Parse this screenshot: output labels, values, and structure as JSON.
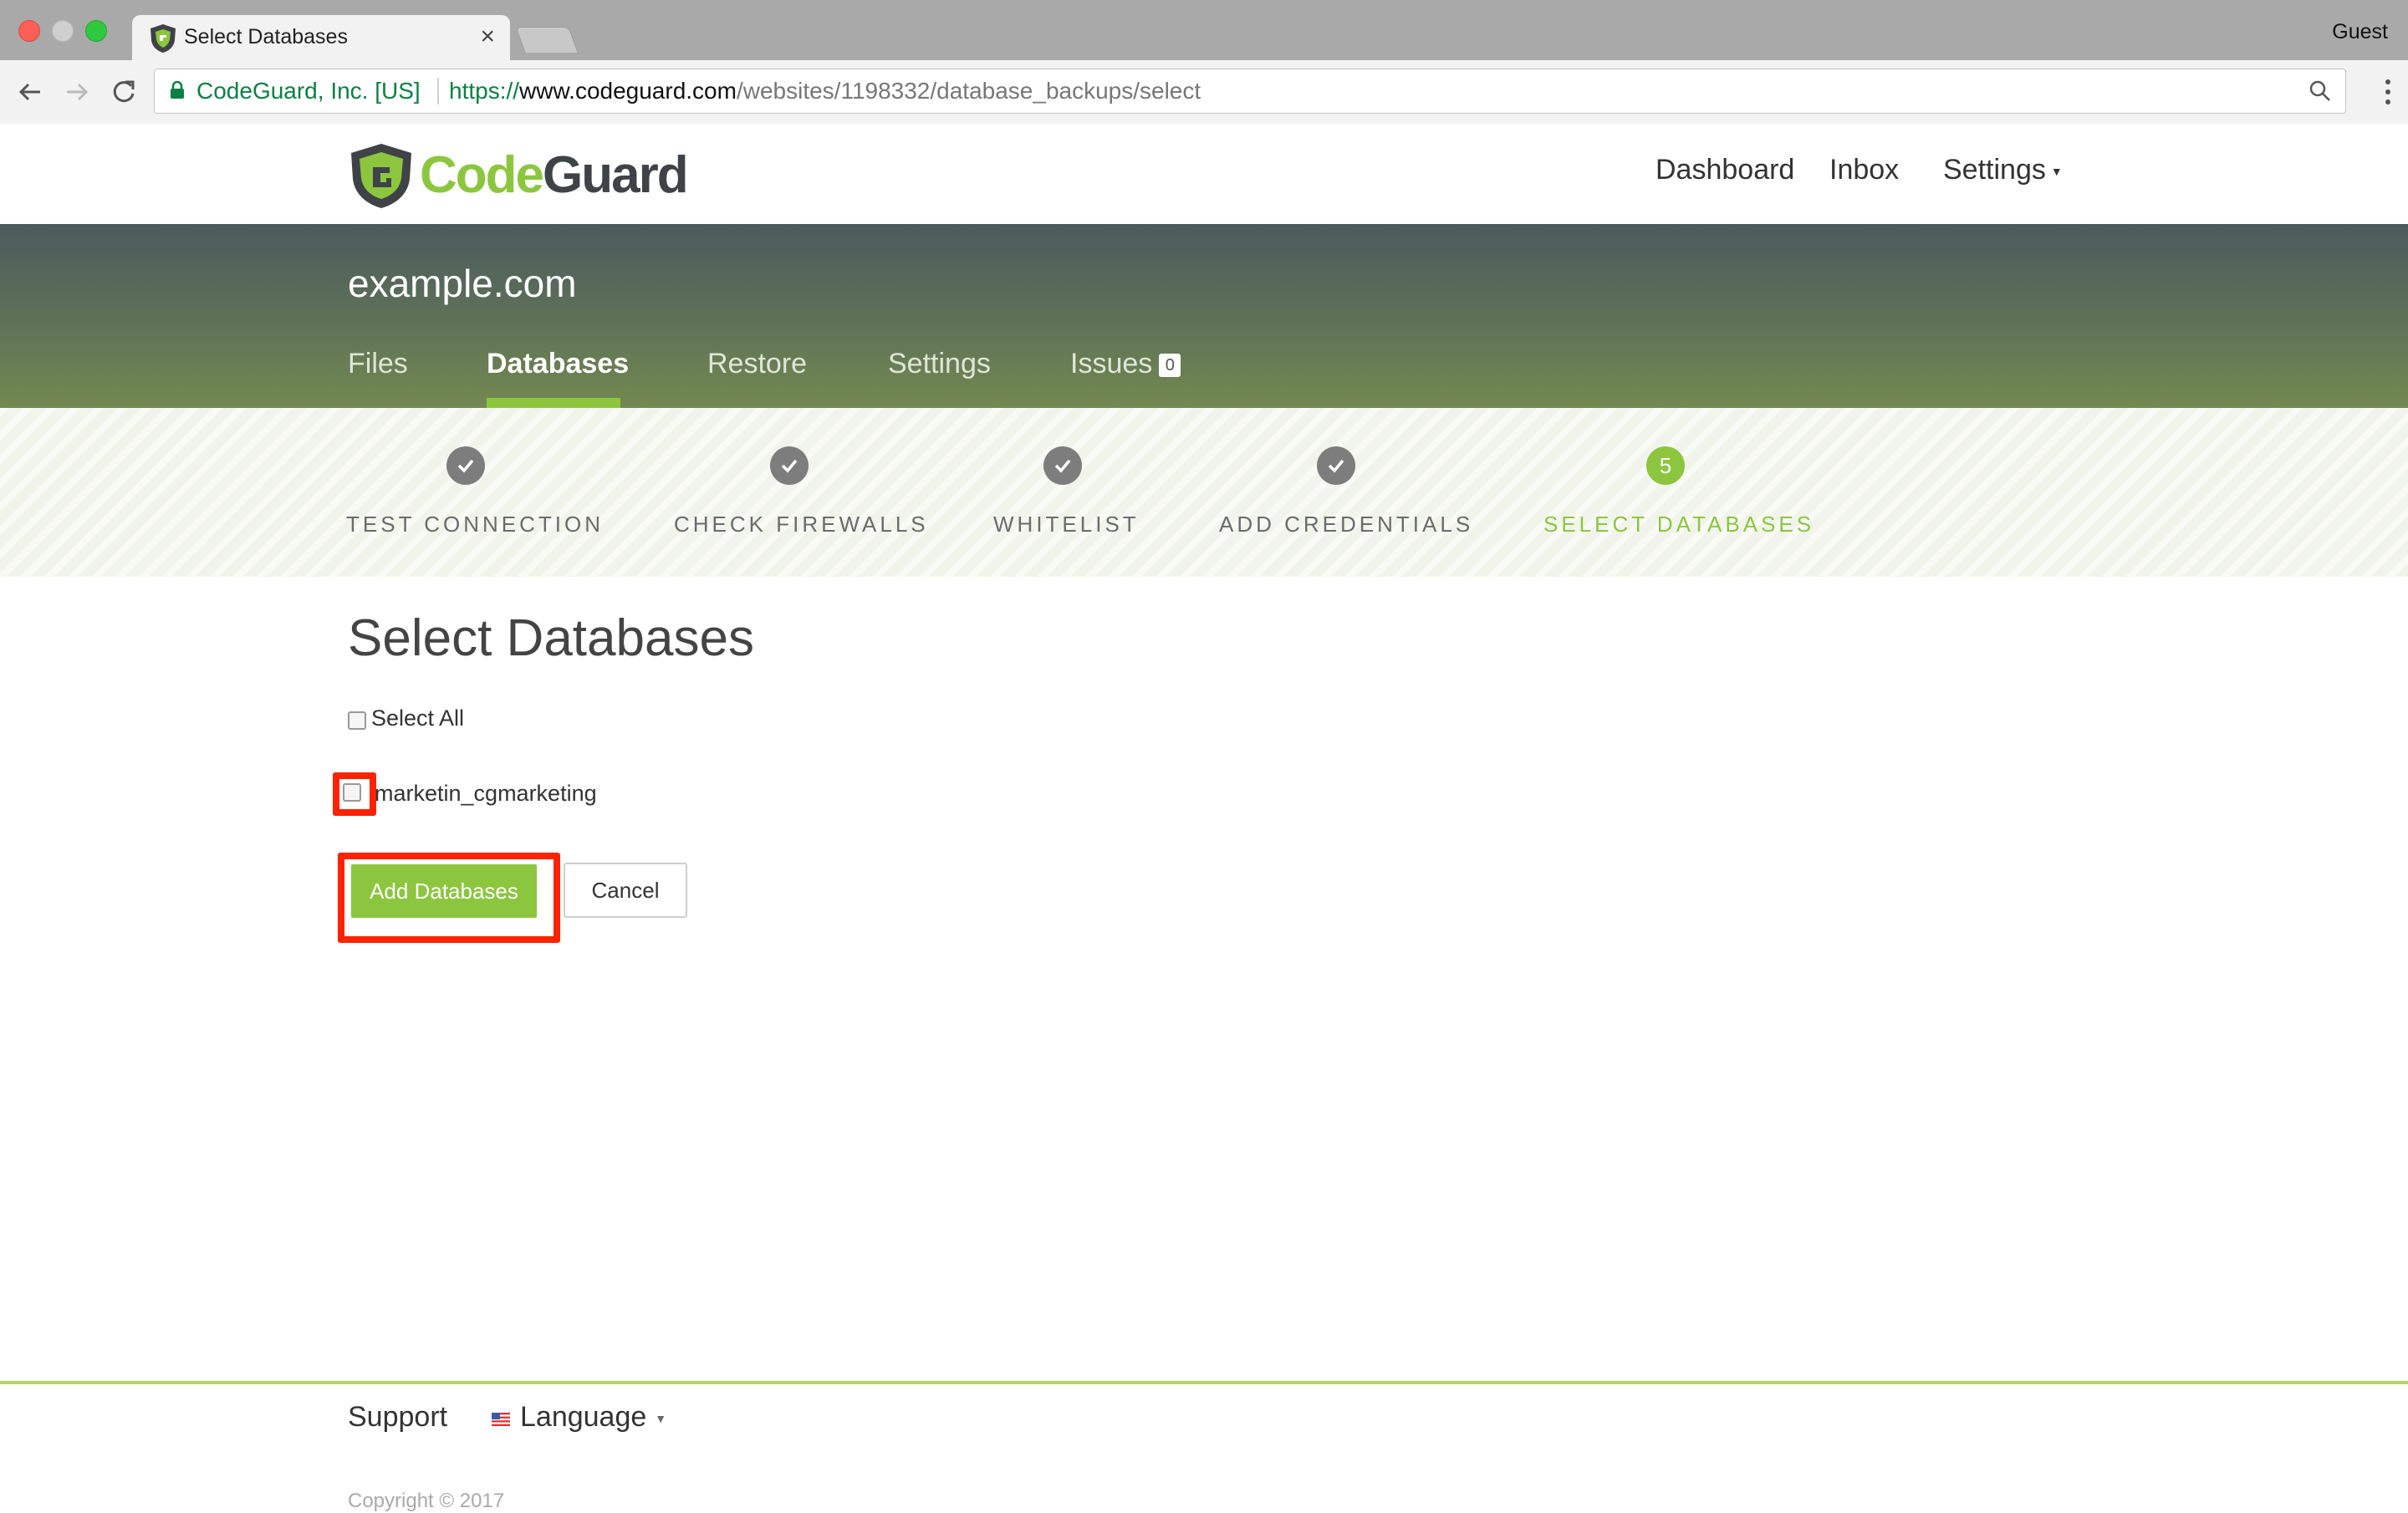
{
  "browser": {
    "tab_title": "Select Databases",
    "tab_close": "×",
    "guest_label": "Guest",
    "security_label": "CodeGuard, Inc. [US]",
    "url_scheme": "https://",
    "url_host": "www.codeguard.com",
    "url_path": "/websites/1198332/database_backups/select"
  },
  "header": {
    "logo_code": "Code",
    "logo_guard": "Guard",
    "nav": {
      "dashboard": "Dashboard",
      "inbox": "Inbox",
      "settings": "Settings"
    }
  },
  "banner": {
    "site_name": "example.com",
    "tabs": {
      "files": "Files",
      "databases": "Databases",
      "restore": "Restore",
      "settings": "Settings",
      "issues": "Issues",
      "issues_count": "0"
    },
    "active_tab": "Databases"
  },
  "wizard": {
    "steps": [
      {
        "label": "TEST CONNECTION",
        "status": "done"
      },
      {
        "label": "CHECK FIREWALLS",
        "status": "done"
      },
      {
        "label": "WHITELIST",
        "status": "done"
      },
      {
        "label": "ADD CREDENTIALS",
        "status": "done"
      },
      {
        "label": "SELECT DATABASES",
        "status": "active",
        "number": "5"
      }
    ]
  },
  "main": {
    "title": "Select Databases",
    "select_all_label": "Select All",
    "databases": [
      {
        "name": "marketin_cgmarketing",
        "checked": false
      }
    ],
    "add_button": "Add Databases",
    "cancel_button": "Cancel"
  },
  "footer": {
    "support": "Support",
    "language": "Language",
    "copyright": "Copyright © 2017"
  },
  "colors": {
    "brand_green": "#8cc63f",
    "highlight_red": "#ff2200",
    "secure_green": "#0b8043"
  },
  "icons": [
    "codeguard-shield-icon",
    "lock-icon",
    "back-arrow-icon",
    "forward-arrow-icon",
    "reload-icon",
    "search-icon",
    "menu-dots-icon",
    "check-icon",
    "caret-down-icon",
    "us-flag-icon"
  ]
}
